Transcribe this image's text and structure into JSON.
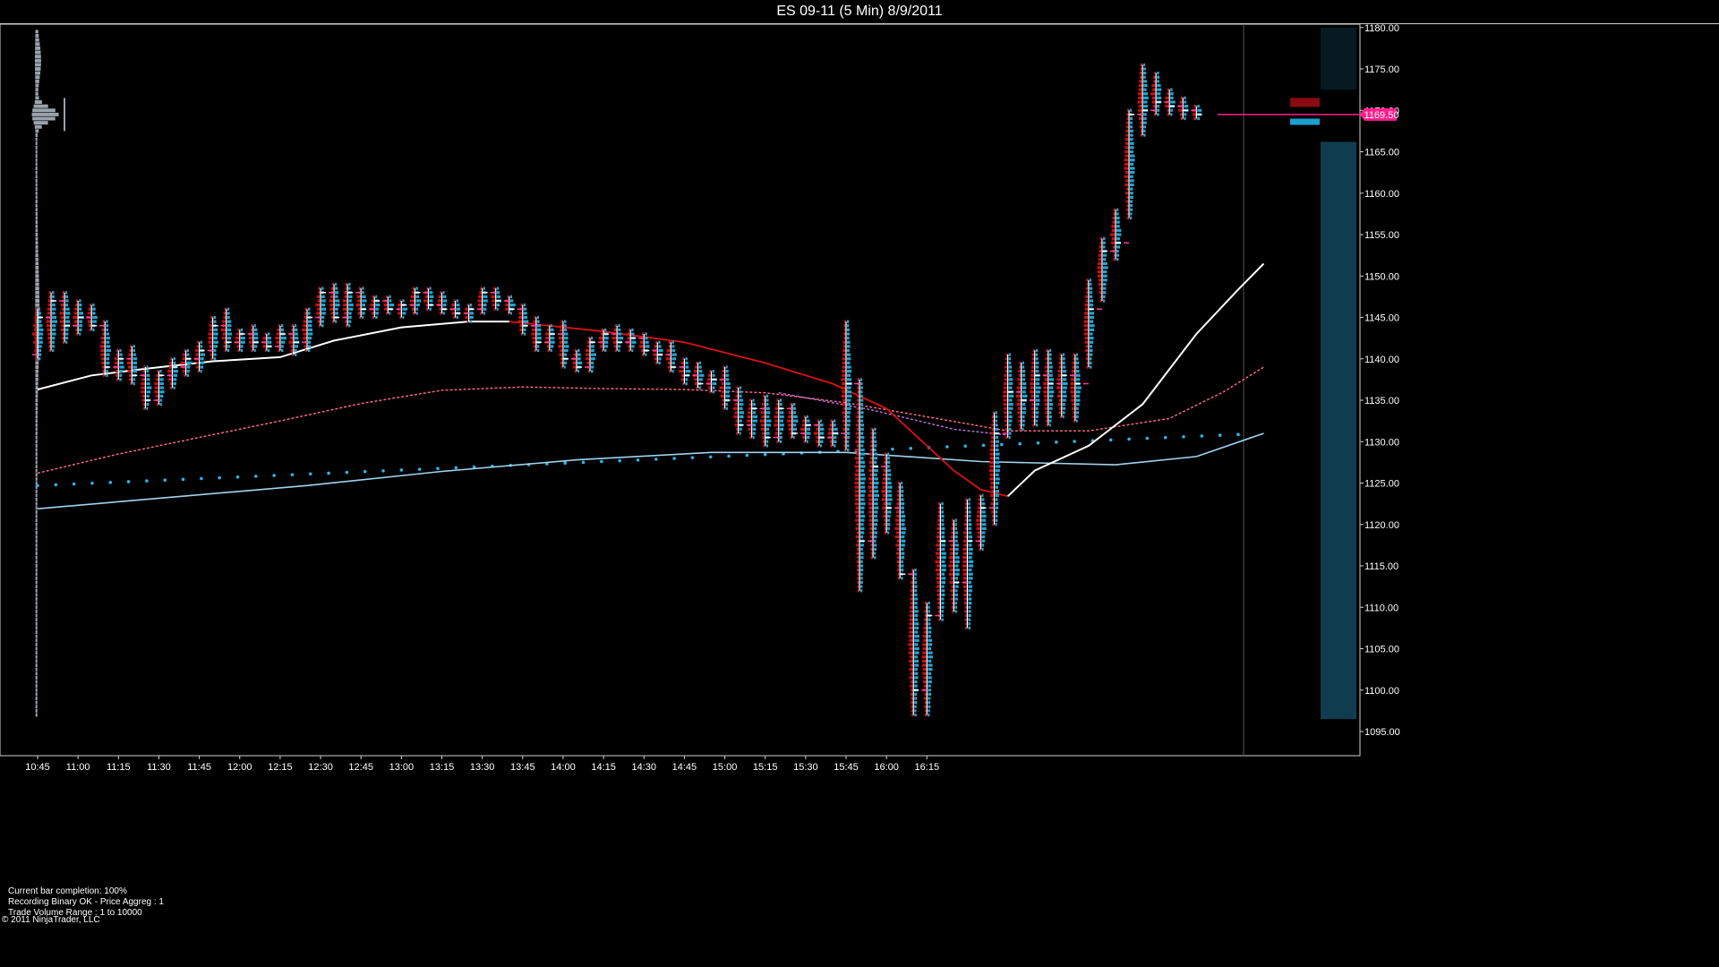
{
  "window": {
    "title": "ES 09-11 (5 Min)  8/9/2011"
  },
  "status": {
    "line1": "Current bar completion: 100%",
    "line2": "Recording Binary OK - Price Aggreg : 1",
    "line3": "Trade Volume Range : 1 to 10000"
  },
  "copyright": "© 2011 NinjaTrader, LLC",
  "colors": {
    "background": "#000000",
    "up_volume": "#1fa7d6",
    "down_volume": "#cc1111",
    "ema_fast": "#ffffff",
    "ema_mid": "#dd1111",
    "ema_slow_dashed": "#ff6b8a",
    "ema_vwap_dashed": "#c070e0",
    "ema_long": "#9fd4f0",
    "dots": "#2bb3e8",
    "price_marker": "#ff1f8e",
    "volume_profile": "#9aa3ad"
  },
  "chart_data": {
    "type": "candlestick-footprint",
    "symbol": "ES 09-11",
    "interval": "5 Min",
    "date": "8/9/2011",
    "ylim": [
      1093.5,
      1180.5
    ],
    "y_ticks": [
      "1095.00",
      "1100.00",
      "1105.00",
      "1110.00",
      "1115.00",
      "1120.00",
      "1125.00",
      "1130.00",
      "1135.00",
      "1140.00",
      "1145.00",
      "1150.00",
      "1155.00",
      "1160.00",
      "1165.00",
      "1170.00",
      "1175.00",
      "1180.00"
    ],
    "x_ticks": [
      "10:45",
      "11:00",
      "11:15",
      "11:30",
      "11:45",
      "12:00",
      "12:15",
      "12:30",
      "12:45",
      "13:00",
      "13:15",
      "13:30",
      "13:45",
      "14:00",
      "14:15",
      "14:30",
      "14:45",
      "15:00",
      "15:15",
      "15:30",
      "15:45",
      "16:00",
      "16:15"
    ],
    "last_price": "1169.50",
    "bars": [
      {
        "o": 1140.5,
        "h": 1146,
        "l": 1140,
        "c": 1145
      },
      {
        "o": 1145,
        "h": 1148,
        "l": 1141,
        "c": 1147
      },
      {
        "o": 1147,
        "h": 1148,
        "l": 1142,
        "c": 1144
      },
      {
        "o": 1144,
        "h": 1147,
        "l": 1143,
        "c": 1145
      },
      {
        "o": 1145,
        "h": 1146.5,
        "l": 1143.5,
        "c": 1144
      },
      {
        "o": 1144,
        "h": 1144.5,
        "l": 1138,
        "c": 1139
      },
      {
        "o": 1139,
        "h": 1141,
        "l": 1137.5,
        "c": 1140
      },
      {
        "o": 1140,
        "h": 1141.5,
        "l": 1137,
        "c": 1138
      },
      {
        "o": 1138,
        "h": 1139,
        "l": 1134,
        "c": 1135
      },
      {
        "o": 1135,
        "h": 1138.5,
        "l": 1134.5,
        "c": 1138
      },
      {
        "o": 1138,
        "h": 1140,
        "l": 1136.5,
        "c": 1139
      },
      {
        "o": 1139,
        "h": 1141,
        "l": 1138,
        "c": 1140
      },
      {
        "o": 1140,
        "h": 1142,
        "l": 1138.5,
        "c": 1141
      },
      {
        "o": 1141,
        "h": 1145,
        "l": 1140,
        "c": 1144
      },
      {
        "o": 1144,
        "h": 1146,
        "l": 1141,
        "c": 1142
      },
      {
        "o": 1142,
        "h": 1143.5,
        "l": 1141,
        "c": 1143
      },
      {
        "o": 1143,
        "h": 1144,
        "l": 1141,
        "c": 1142
      },
      {
        "o": 1142,
        "h": 1143,
        "l": 1141,
        "c": 1141.5
      },
      {
        "o": 1141.5,
        "h": 1144,
        "l": 1141,
        "c": 1143
      },
      {
        "o": 1143,
        "h": 1144,
        "l": 1140.5,
        "c": 1142
      },
      {
        "o": 1142,
        "h": 1146,
        "l": 1141,
        "c": 1145
      },
      {
        "o": 1145,
        "h": 1148.5,
        "l": 1144,
        "c": 1148
      },
      {
        "o": 1148,
        "h": 1149,
        "l": 1144.5,
        "c": 1145
      },
      {
        "o": 1145,
        "h": 1149,
        "l": 1144,
        "c": 1148
      },
      {
        "o": 1148,
        "h": 1148.5,
        "l": 1145,
        "c": 1146
      },
      {
        "o": 1146,
        "h": 1147.5,
        "l": 1145,
        "c": 1147
      },
      {
        "o": 1147,
        "h": 1147.5,
        "l": 1145.5,
        "c": 1146
      },
      {
        "o": 1146,
        "h": 1147,
        "l": 1145,
        "c": 1146.5
      },
      {
        "o": 1146.5,
        "h": 1148.5,
        "l": 1145.5,
        "c": 1148
      },
      {
        "o": 1148,
        "h": 1148.5,
        "l": 1146,
        "c": 1146.5
      },
      {
        "o": 1146.5,
        "h": 1148,
        "l": 1145.5,
        "c": 1146
      },
      {
        "o": 1146,
        "h": 1147,
        "l": 1145,
        "c": 1145.5
      },
      {
        "o": 1145.5,
        "h": 1146.5,
        "l": 1144.5,
        "c": 1146
      },
      {
        "o": 1146,
        "h": 1148.5,
        "l": 1145.5,
        "c": 1148
      },
      {
        "o": 1148,
        "h": 1148.5,
        "l": 1146,
        "c": 1147
      },
      {
        "o": 1147,
        "h": 1147.5,
        "l": 1145.5,
        "c": 1146
      },
      {
        "o": 1146,
        "h": 1146.5,
        "l": 1143,
        "c": 1144
      },
      {
        "o": 1144,
        "h": 1145,
        "l": 1141,
        "c": 1142
      },
      {
        "o": 1142,
        "h": 1144,
        "l": 1141,
        "c": 1143
      },
      {
        "o": 1143,
        "h": 1144.5,
        "l": 1139,
        "c": 1140
      },
      {
        "o": 1140,
        "h": 1141,
        "l": 1138.5,
        "c": 1139
      },
      {
        "o": 1139,
        "h": 1142.5,
        "l": 1138.5,
        "c": 1142
      },
      {
        "o": 1142,
        "h": 1143.5,
        "l": 1141,
        "c": 1143
      },
      {
        "o": 1143,
        "h": 1144,
        "l": 1141,
        "c": 1142
      },
      {
        "o": 1142,
        "h": 1143.5,
        "l": 1141,
        "c": 1142.5
      },
      {
        "o": 1142.5,
        "h": 1143,
        "l": 1140.5,
        "c": 1141
      },
      {
        "o": 1141,
        "h": 1142,
        "l": 1139.5,
        "c": 1140.5
      },
      {
        "o": 1140.5,
        "h": 1142,
        "l": 1138.5,
        "c": 1139
      },
      {
        "o": 1139,
        "h": 1140,
        "l": 1137,
        "c": 1138
      },
      {
        "o": 1138,
        "h": 1139.5,
        "l": 1136.5,
        "c": 1137
      },
      {
        "o": 1137,
        "h": 1138.5,
        "l": 1136,
        "c": 1137.5
      },
      {
        "o": 1137.5,
        "h": 1139,
        "l": 1134,
        "c": 1135
      },
      {
        "o": 1135,
        "h": 1136.5,
        "l": 1131,
        "c": 1132
      },
      {
        "o": 1132,
        "h": 1135,
        "l": 1130.5,
        "c": 1134
      },
      {
        "o": 1134,
        "h": 1135.5,
        "l": 1129.5,
        "c": 1130.5
      },
      {
        "o": 1130.5,
        "h": 1135,
        "l": 1130,
        "c": 1134
      },
      {
        "o": 1134,
        "h": 1134.5,
        "l": 1130.5,
        "c": 1131
      },
      {
        "o": 1131,
        "h": 1133,
        "l": 1130,
        "c": 1132
      },
      {
        "o": 1132,
        "h": 1132.5,
        "l": 1129.5,
        "c": 1130.5
      },
      {
        "o": 1130.5,
        "h": 1132.5,
        "l": 1129.5,
        "c": 1131
      },
      {
        "o": 1131,
        "h": 1144.5,
        "l": 1129,
        "c": 1137
      },
      {
        "o": 1137,
        "h": 1137.5,
        "l": 1112,
        "c": 1118
      },
      {
        "o": 1118,
        "h": 1131.5,
        "l": 1116,
        "c": 1127
      },
      {
        "o": 1127,
        "h": 1128.5,
        "l": 1119,
        "c": 1122
      },
      {
        "o": 1122,
        "h": 1125,
        "l": 1113.5,
        "c": 1114
      },
      {
        "o": 1114,
        "h": 1114.5,
        "l": 1097,
        "c": 1100
      },
      {
        "o": 1100,
        "h": 1110.5,
        "l": 1097,
        "c": 1109
      },
      {
        "o": 1109,
        "h": 1122.5,
        "l": 1108.5,
        "c": 1118
      },
      {
        "o": 1118,
        "h": 1120.5,
        "l": 1109.5,
        "c": 1113
      },
      {
        "o": 1113,
        "h": 1123,
        "l": 1107.5,
        "c": 1118
      },
      {
        "o": 1118,
        "h": 1123.5,
        "l": 1117,
        "c": 1122
      },
      {
        "o": 1122,
        "h": 1133.5,
        "l": 1120,
        "c": 1131
      },
      {
        "o": 1131,
        "h": 1140.5,
        "l": 1130.5,
        "c": 1136
      },
      {
        "o": 1136,
        "h": 1139.5,
        "l": 1131.5,
        "c": 1135
      },
      {
        "o": 1135,
        "h": 1141,
        "l": 1132,
        "c": 1138
      },
      {
        "o": 1138,
        "h": 1141,
        "l": 1132,
        "c": 1137
      },
      {
        "o": 1137,
        "h": 1140.5,
        "l": 1133,
        "c": 1138
      },
      {
        "o": 1138,
        "h": 1140.5,
        "l": 1132.5,
        "c": 1137
      },
      {
        "o": 1137,
        "h": 1149.5,
        "l": 1139,
        "c": 1146
      },
      {
        "o": 1146,
        "h": 1154.5,
        "l": 1147,
        "c": 1153
      },
      {
        "o": 1153,
        "h": 1158,
        "l": 1152,
        "c": 1154
      },
      {
        "o": 1154,
        "h": 1170,
        "l": 1157,
        "c": 1169.5
      },
      {
        "o": 1169.5,
        "h": 1175.5,
        "l": 1167,
        "c": 1170
      },
      {
        "o": 1170,
        "h": 1174.5,
        "l": 1169.5,
        "c": 1171
      },
      {
        "o": 1171,
        "h": 1172.5,
        "l": 1169.5,
        "c": 1170.5
      },
      {
        "o": 1170.5,
        "h": 1171.5,
        "l": 1169,
        "c": 1170
      },
      {
        "o": 1170,
        "h": 1170.5,
        "l": 1169,
        "c": 1169.5
      }
    ],
    "ema_fast": [
      [
        0,
        1136.3
      ],
      [
        4,
        1138
      ],
      [
        8,
        1138.8
      ],
      [
        13,
        1139.7
      ],
      [
        18,
        1140.2
      ],
      [
        22,
        1142.2
      ],
      [
        27,
        1143.8
      ],
      [
        32,
        1144.5
      ],
      [
        35,
        1144.5
      ]
    ],
    "ema_mid": [
      [
        35,
        1144.5
      ],
      [
        42,
        1143.3
      ],
      [
        48,
        1142
      ],
      [
        54,
        1139.5
      ],
      [
        59,
        1137
      ],
      [
        63,
        1134
      ],
      [
        65,
        1131
      ],
      [
        68,
        1126.5
      ],
      [
        70,
        1124.2
      ],
      [
        72,
        1123.4
      ]
    ],
    "ema_fast_2": [
      [
        72,
        1123.4
      ],
      [
        74,
        1126.5
      ],
      [
        78,
        1129.5
      ],
      [
        82,
        1134.5
      ],
      [
        86,
        1143
      ],
      [
        89,
        1148.2
      ],
      [
        91,
        1151.5
      ]
    ],
    "ema_dashed_pink": [
      [
        0,
        1126.2
      ],
      [
        6,
        1128.5
      ],
      [
        12,
        1130.5
      ],
      [
        18,
        1132.5
      ],
      [
        24,
        1134.6
      ],
      [
        30,
        1136.2
      ],
      [
        36,
        1136.6
      ],
      [
        42,
        1136.4
      ],
      [
        48,
        1136.3
      ],
      [
        54,
        1135.9
      ],
      [
        60,
        1134.7
      ],
      [
        66,
        1133
      ],
      [
        72,
        1131.3
      ],
      [
        78,
        1131.3
      ],
      [
        84,
        1132.8
      ],
      [
        88,
        1136
      ],
      [
        91,
        1139
      ]
    ],
    "ema_long": [
      [
        0,
        1121.9
      ],
      [
        10,
        1123.3
      ],
      [
        20,
        1124.7
      ],
      [
        30,
        1126.4
      ],
      [
        40,
        1127.8
      ],
      [
        50,
        1128.7
      ],
      [
        60,
        1128.7
      ],
      [
        70,
        1127.6
      ],
      [
        80,
        1127.2
      ],
      [
        86,
        1128.2
      ],
      [
        91,
        1131
      ]
    ],
    "ema_dashed_purple": [
      [
        55,
        1135.9
      ],
      [
        62,
        1133.8
      ],
      [
        68,
        1131.5
      ],
      [
        72,
        1130.8
      ]
    ],
    "dots": [
      [
        0,
        1124.7
      ],
      [
        91,
        1131
      ]
    ]
  }
}
